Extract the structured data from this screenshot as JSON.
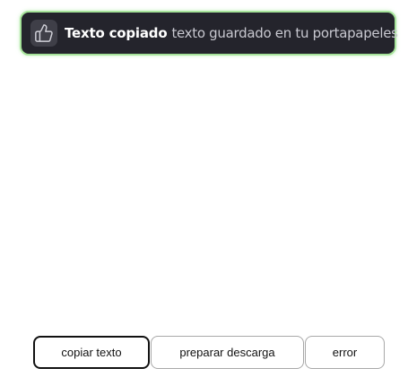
{
  "toast": {
    "icon": "thumbs-up-icon",
    "title": "Texto copiado",
    "message": "texto guardado en tu portapapeles",
    "accent_color": "#a6e39a",
    "background_color": "#24242c"
  },
  "buttons": {
    "copy_label": "copiar texto",
    "prepare_label": "preparar descarga",
    "error_label": "error"
  }
}
